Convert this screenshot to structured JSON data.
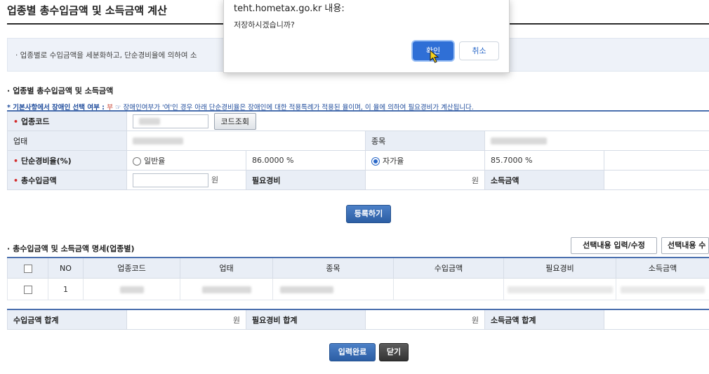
{
  "page_title": "업종별 총수입금액 및 소득금액 계산",
  "notice": "· 업종별로 수입금액을 세분화하고, 단순경비율에 의하여 소",
  "section1_title": "업종별 총수입금액 및 소득금액",
  "hint": {
    "prefix": "* 기본사항에서 장애인 선택 여부 : ",
    "flag": "부",
    "text": " ☞ 장애인여부가 '여'인 경우 아래 단순경비율은 장애인에 대한 적용특례가 적용된 율이며, 이 율에 의하여 필요경비가 계산됩니다."
  },
  "form": {
    "industry_code_label": "업종코드",
    "code_lookup_button": "코드조회",
    "business_type_label": "업태",
    "item_label": "종목",
    "simple_rate_label": "단순경비율(%)",
    "general_rate_label": "일반율",
    "general_rate_value": "86.0000 %",
    "self_rate_label": "자가율",
    "self_rate_value": "85.7000 %",
    "total_income_label": "총수입금액",
    "won": "원",
    "expense_label": "필요경비",
    "income_label": "소득금액"
  },
  "register_button": "등록하기",
  "section2_title": "총수입금액 및 소득금액 명세(업종별)",
  "select_edit_button": "선택내용 입력/수정",
  "select_delete_button": "선택내용 수",
  "grid": {
    "headers": [
      "NO",
      "업종코드",
      "업태",
      "종목",
      "수입금액",
      "필요경비",
      "소득금액"
    ],
    "rows": [
      {
        "no": "1"
      }
    ]
  },
  "totals": {
    "income_total_label": "수입금액 합계",
    "expense_total_label": "필요경비 합계",
    "income_amount_total_label": "소득금액 합계",
    "won": "원"
  },
  "complete_button": "입력완료",
  "close_button": "닫기",
  "dialog": {
    "title": "teht.hometax.go.kr 내용:",
    "message": "저장하시겠습니까?",
    "ok": "확인",
    "cancel": "취소"
  },
  "colors": {
    "accent_blue": "#2c5ea4",
    "label_bg": "#e9eef6",
    "dialog_ok": "#2f6fd6"
  }
}
